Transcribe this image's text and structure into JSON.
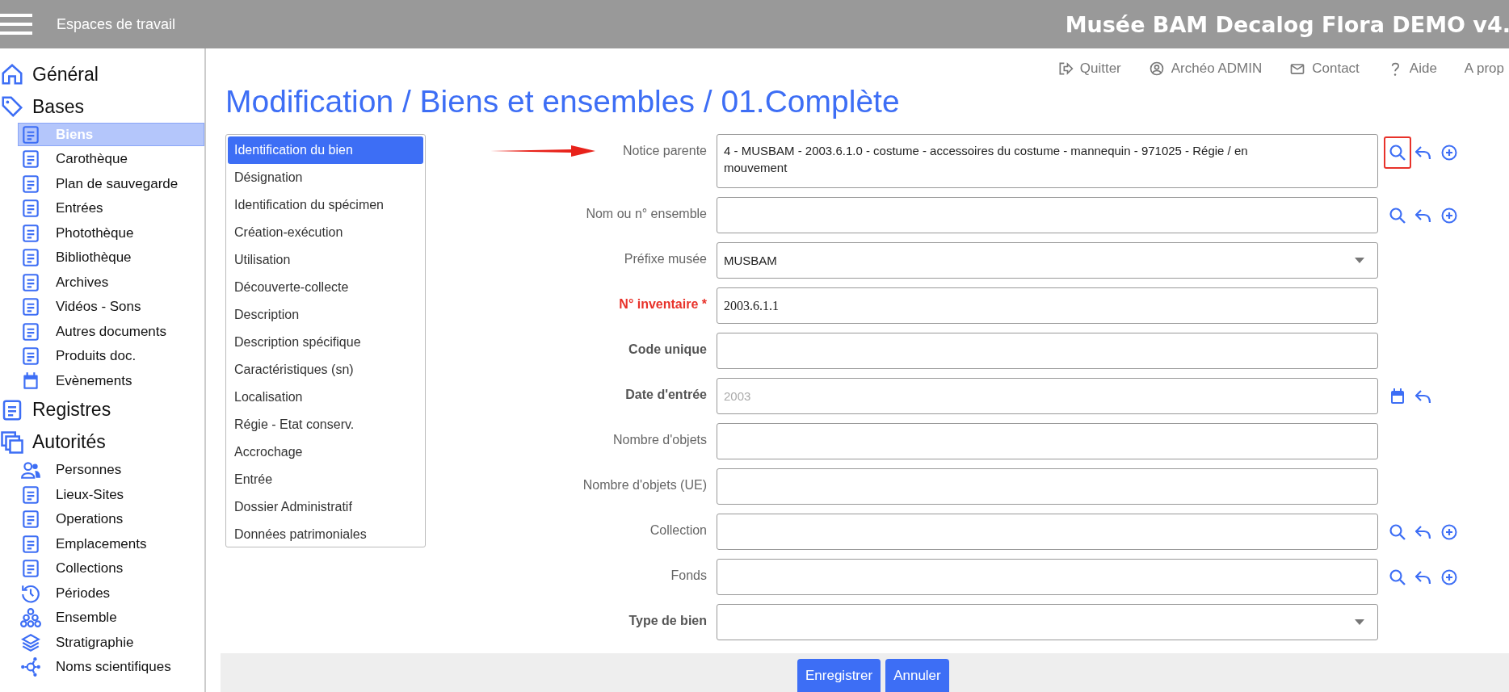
{
  "header": {
    "workspace": "Espaces de travail",
    "app_title": "Musée BAM Decalog Flora DEMO v4."
  },
  "sidebar": [
    {
      "label": "Général",
      "selected": false
    },
    {
      "label": "Bases",
      "selected": false,
      "children": [
        {
          "label": "Biens",
          "selected": true
        },
        {
          "label": "Carothèque",
          "selected": false
        },
        {
          "label": "Plan de sauvegarde",
          "selected": false
        },
        {
          "label": "Entrées",
          "selected": false
        },
        {
          "label": "Photothèque",
          "selected": false
        },
        {
          "label": "Bibliothèque",
          "selected": false
        },
        {
          "label": "Archives",
          "selected": false
        },
        {
          "label": "Vidéos - Sons",
          "selected": false
        },
        {
          "label": "Autres documents",
          "selected": false
        },
        {
          "label": "Produits doc.",
          "selected": false
        },
        {
          "label": "Evènements",
          "selected": false
        }
      ]
    },
    {
      "label": "Registres",
      "selected": false
    },
    {
      "label": "Autorités",
      "selected": false,
      "children": [
        {
          "label": "Personnes",
          "selected": false
        },
        {
          "label": "Lieux-Sites",
          "selected": false
        },
        {
          "label": "Operations",
          "selected": false
        },
        {
          "label": "Emplacements",
          "selected": false
        },
        {
          "label": "Collections",
          "selected": false
        },
        {
          "label": "Périodes",
          "selected": false
        },
        {
          "label": "Ensemble",
          "selected": false
        },
        {
          "label": "Stratigraphie",
          "selected": false
        },
        {
          "label": "Noms scientifiques",
          "selected": false
        }
      ]
    }
  ],
  "top_links": [
    {
      "label": "Quitter"
    },
    {
      "label": "Archéo ADMIN"
    },
    {
      "label": "Contact"
    },
    {
      "label": "Aide"
    },
    {
      "label": "A prop"
    }
  ],
  "page_title": "Modification / Biens et ensembles / 01.Complète",
  "section_nav": [
    {
      "label": "Identification du bien",
      "selected": true
    },
    {
      "label": "Désignation",
      "selected": false
    },
    {
      "label": "Identification du spécimen",
      "selected": false
    },
    {
      "label": "Création-exécution",
      "selected": false
    },
    {
      "label": "Utilisation",
      "selected": false
    },
    {
      "label": "Découverte-collecte",
      "selected": false
    },
    {
      "label": "Description",
      "selected": false
    },
    {
      "label": "Description spécifique",
      "selected": false
    },
    {
      "label": "Caractéristiques (sn)",
      "selected": false
    },
    {
      "label": "Localisation",
      "selected": false
    },
    {
      "label": "Régie - Etat conserv.",
      "selected": false
    },
    {
      "label": "Accrochage",
      "selected": false
    },
    {
      "label": "Entrée",
      "selected": false
    },
    {
      "label": "Dossier Administratif",
      "selected": false
    },
    {
      "label": "Données patrimoniales",
      "selected": false
    }
  ],
  "fields": [
    {
      "label": "Notice parente",
      "kind": "textarea",
      "bold": false,
      "required": false,
      "value": "4 - MUSBAM - 2003.6.1.0 - costume - accessoires du costume - mannequin - 971025 - Régie / en mouvement",
      "pointer_arrow": true,
      "actions": [
        {
          "kind": "search",
          "highlighted": true
        },
        {
          "kind": "undo",
          "highlighted": false
        },
        {
          "kind": "add",
          "highlighted": false
        }
      ]
    },
    {
      "label": "Nom ou n° ensemble",
      "kind": "text",
      "bold": false,
      "required": false,
      "actions": [
        {
          "kind": "search",
          "highlighted": false
        },
        {
          "kind": "undo",
          "highlighted": false
        },
        {
          "kind": "add",
          "highlighted": false
        }
      ]
    },
    {
      "label": "Préfixe musée",
      "kind": "select",
      "bold": false,
      "required": false,
      "value": "MUSBAM"
    },
    {
      "label": "N° inventaire *",
      "kind": "text",
      "bold": true,
      "required": true,
      "value": "2003.6.1.1"
    },
    {
      "label": "Code unique",
      "kind": "text",
      "bold": true,
      "required": false
    },
    {
      "label": "Date d'entrée",
      "kind": "text",
      "bold": true,
      "required": false,
      "placeholder": "2003",
      "actions": [
        {
          "kind": "calendar",
          "highlighted": false
        },
        {
          "kind": "undo",
          "highlighted": false
        }
      ]
    },
    {
      "label": "Nombre d'objets",
      "kind": "text",
      "bold": false,
      "required": false
    },
    {
      "label": "Nombre d'objets (UE)",
      "kind": "text",
      "bold": false,
      "required": false
    },
    {
      "label": "Collection",
      "kind": "text",
      "bold": false,
      "required": false,
      "actions": [
        {
          "kind": "search",
          "highlighted": false
        },
        {
          "kind": "undo",
          "highlighted": false
        },
        {
          "kind": "add",
          "highlighted": false
        }
      ]
    },
    {
      "label": "Fonds",
      "kind": "text",
      "bold": false,
      "required": false,
      "actions": [
        {
          "kind": "search",
          "highlighted": false
        },
        {
          "kind": "undo",
          "highlighted": false
        },
        {
          "kind": "add",
          "highlighted": false
        }
      ]
    },
    {
      "label": "Type de bien",
      "kind": "select",
      "bold": true,
      "required": false
    }
  ],
  "buttons": [
    {
      "label": "Enregistrer"
    },
    {
      "label": "Annuler"
    }
  ]
}
